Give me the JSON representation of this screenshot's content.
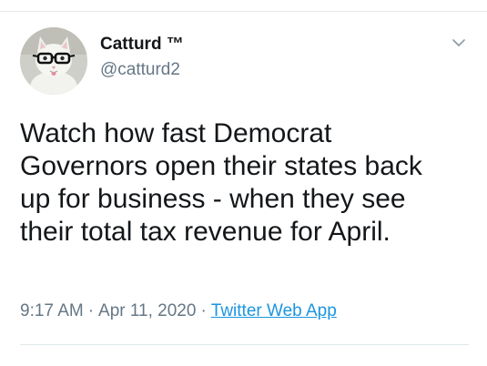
{
  "tweet": {
    "author": {
      "display_name": "Catturd ™",
      "handle": "@catturd2",
      "avatar_icon": "cat-with-glasses-avatar"
    },
    "menu_icon": "chevron-down-icon",
    "text": "Watch how fast Democrat\nGovernors open their states back\nup for business - when they see\ntheir total tax revenue for April.",
    "time": "9:17 AM",
    "date": "Apr 11, 2020",
    "separator": "·",
    "source": "Twitter Web App"
  },
  "colors": {
    "text": "#14171a",
    "secondary": "#657786",
    "link": "#1b95e0",
    "divider": "#e1e8ed"
  }
}
